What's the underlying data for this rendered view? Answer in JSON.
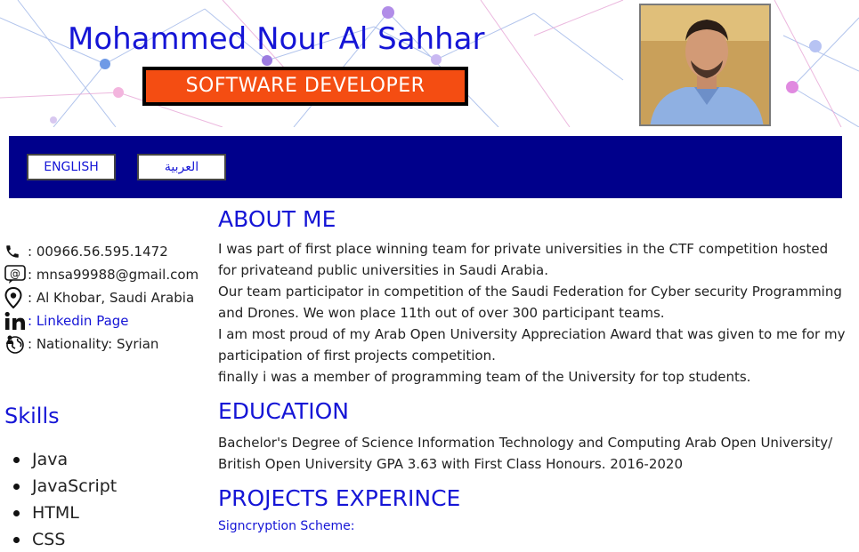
{
  "header": {
    "name": "Mohammed Nour Al Sahhar",
    "role": "SOFTWARE DEVELOPER"
  },
  "nav": {
    "lang_english": "ENGLISH",
    "lang_arabic": "العربية"
  },
  "contact": {
    "phone": ": 00966.56.595.1472",
    "email": ": mnsa99988@gmail.com",
    "location": ": Al Khobar, Saudi Arabia",
    "linkedin": ": Linkedin Page",
    "nationality": ": Nationality: Syrian"
  },
  "skills": {
    "title": "Skills",
    "items": [
      "Java",
      "JavaScript",
      "HTML",
      "CSS"
    ]
  },
  "about": {
    "title": "ABOUT ME",
    "lines": [
      "I was part of first place winning team for private universities in the CTF competition hosted for privateand public universities in Saudi Arabia.",
      "Our team participator in competition of the Saudi Federation for Cyber security Programming and Drones. We won place 11th out of over 300 participant teams.",
      "I am most proud of my Arab Open University Appreciation Award that was given to me for my participation of first projects competition.",
      "finally i was a member of programming team of the University for top students."
    ]
  },
  "education": {
    "title": "EDUCATION",
    "text": "Bachelor's Degree of Science Information Technology and Computing Arab Open University/ British Open University GPA 3.63 with First Class Honours. 2016-2020"
  },
  "projects": {
    "title": "PROJECTS EXPERINCE",
    "first_item": "Signcryption Scheme:"
  },
  "colors": {
    "accent_blue": "#1515d6",
    "nav_bg": "#00008b",
    "badge_orange": "#f44d12"
  }
}
